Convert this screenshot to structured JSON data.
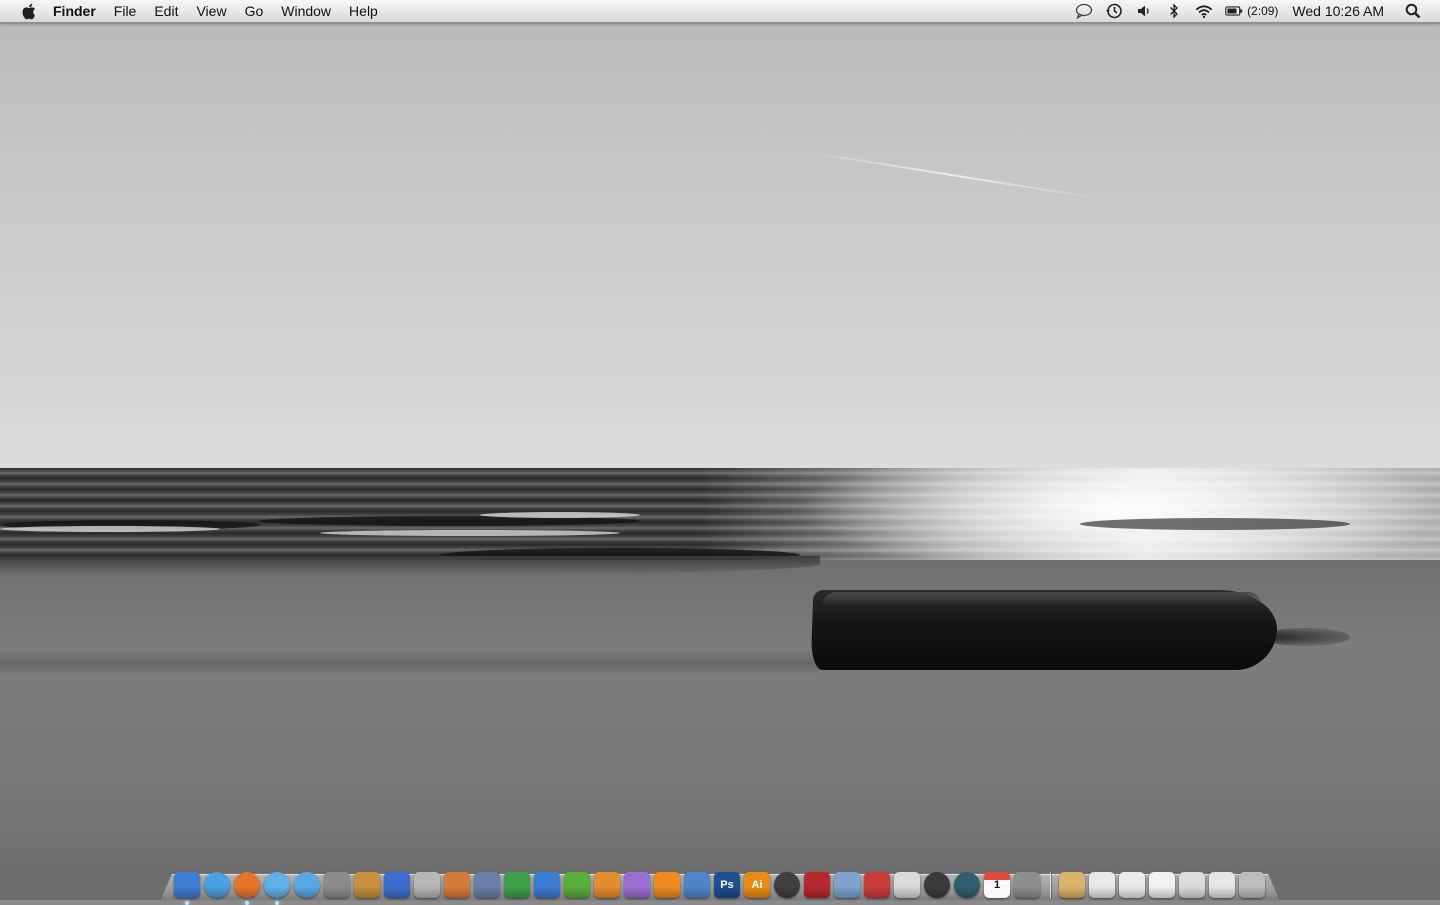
{
  "menubar": {
    "app_name": "Finder",
    "menus": [
      "File",
      "Edit",
      "View",
      "Go",
      "Window",
      "Help"
    ],
    "battery_time": "(2:09)",
    "clock": "Wed 10:26 AM",
    "status_icons": [
      "chat-status-icon",
      "time-machine-icon",
      "volume-icon",
      "bluetooth-icon",
      "wifi-icon",
      "battery-icon",
      "spotlight-icon"
    ]
  },
  "dock": {
    "apps": [
      {
        "name": "finder",
        "running": true
      },
      {
        "name": "safari",
        "running": false
      },
      {
        "name": "firefox",
        "running": true
      },
      {
        "name": "itunes",
        "running": true
      },
      {
        "name": "ichat",
        "running": false
      },
      {
        "name": "iphoto",
        "running": false
      },
      {
        "name": "garageband",
        "running": false
      },
      {
        "name": "imovie",
        "running": false
      },
      {
        "name": "idvd",
        "running": false
      },
      {
        "name": "keynote",
        "running": false
      },
      {
        "name": "script-editor",
        "running": false
      },
      {
        "name": "numbers",
        "running": false
      },
      {
        "name": "word",
        "running": false
      },
      {
        "name": "excel",
        "running": false
      },
      {
        "name": "powerpoint",
        "running": false
      },
      {
        "name": "entourage",
        "running": false
      },
      {
        "name": "vlc",
        "running": false
      },
      {
        "name": "xcode",
        "running": false
      },
      {
        "name": "photoshop",
        "running": false,
        "label": "Ps"
      },
      {
        "name": "illustrator",
        "running": false,
        "label": "Ai"
      },
      {
        "name": "aperture",
        "running": false
      },
      {
        "name": "final-cut",
        "running": false
      },
      {
        "name": "preview",
        "running": false
      },
      {
        "name": "vmware",
        "running": false
      },
      {
        "name": "x11",
        "running": false
      },
      {
        "name": "osx-app",
        "running": false
      },
      {
        "name": "time-machine",
        "running": false
      },
      {
        "name": "ical",
        "running": false,
        "label": "1"
      },
      {
        "name": "system-preferences",
        "running": false
      }
    ],
    "stacks": [
      {
        "name": "documents-stack"
      },
      {
        "name": "pdf-stack"
      },
      {
        "name": "pages-doc-stack"
      },
      {
        "name": "text-doc-stack"
      },
      {
        "name": "screenshots-stack"
      },
      {
        "name": "downloads-stack"
      },
      {
        "name": "trash"
      }
    ],
    "colors": {
      "finder": "#3f7ed6",
      "safari": "#4aa0e0",
      "firefox": "#e8742a",
      "itunes": "#5fb0e8",
      "ichat": "#5aa7e4",
      "iphoto": "#8c8c8c",
      "garageband": "#c89040",
      "imovie": "#3d6ecf",
      "idvd": "#b7b7b7",
      "keynote": "#d57b3a",
      "script-editor": "#6b7fa8",
      "numbers": "#3da14c",
      "word": "#3a7cd3",
      "excel": "#5aaf3a",
      "powerpoint": "#e58c2f",
      "entourage": "#9a6fd1",
      "vlc": "#f08a20",
      "xcode": "#4e86c9",
      "photoshop": "#1f4e91",
      "illustrator": "#e88b16",
      "aperture": "#404040",
      "final-cut": "#b52a2a",
      "preview": "#7ea3cf",
      "vmware": "#c93c3c",
      "x11": "#d9d9d9",
      "osx-app": "#3b3b3b",
      "time-machine": "#2f5e6e",
      "ical": "#e04a3a",
      "system-preferences": "#8e8e8e",
      "documents-stack": "#d9b46a",
      "pdf-stack": "#e9e9e9",
      "pages-doc-stack": "#eaeaea",
      "text-doc-stack": "#f2f2f2",
      "screenshots-stack": "#dcdcdc",
      "downloads-stack": "#e6e6e6",
      "trash": "#bdbdbd"
    }
  }
}
